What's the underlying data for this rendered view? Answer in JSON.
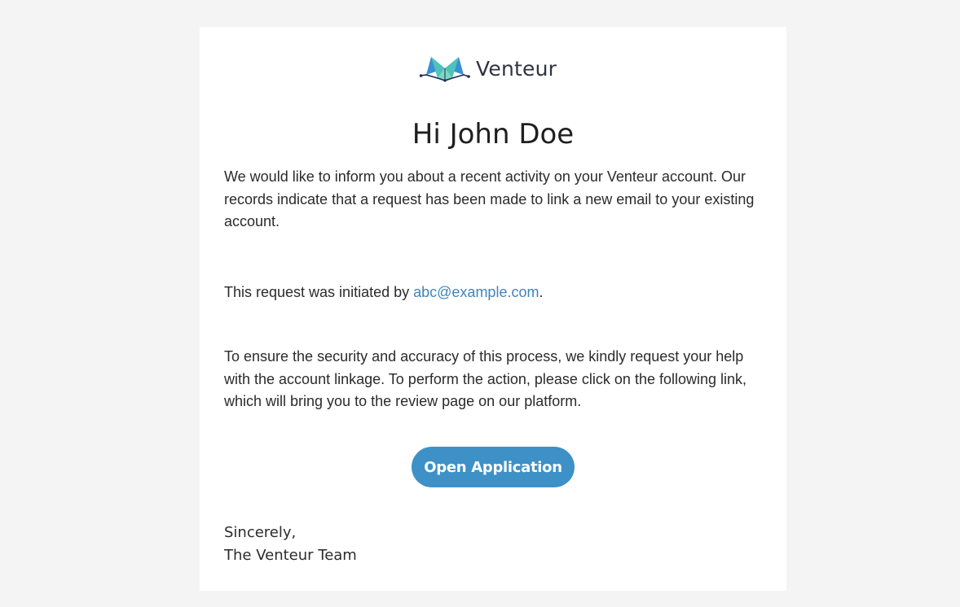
{
  "brand": {
    "name": "Venteur",
    "logo_icon": "venteur-logo-icon",
    "colors": {
      "teal": "#4fc3b8",
      "blue": "#3a8fd6",
      "navy": "#1b2a5a"
    }
  },
  "email": {
    "greeting": "Hi John Doe",
    "paragraph1": "We would like to inform you about a recent activity on your Venteur account. Our records indicate that a request has been made to link a new email to your existing account.",
    "paragraph2_prefix": "This request was initiated by ",
    "initiator_email": "abc@example.com",
    "paragraph2_suffix": ".",
    "paragraph3": "To ensure the security and accuracy of this process, we kindly request your help with the account linkage. To perform the action, please click on the following link, which will bring you to the review page on our platform.",
    "cta_label": "Open Application",
    "signoff_line1": "Sincerely,",
    "signoff_line2": "The Venteur Team"
  },
  "theme": {
    "page_background": "#f4f4f4",
    "card_background": "#ffffff",
    "button_color": "#3d91c7",
    "link_color": "#3d85c0"
  }
}
